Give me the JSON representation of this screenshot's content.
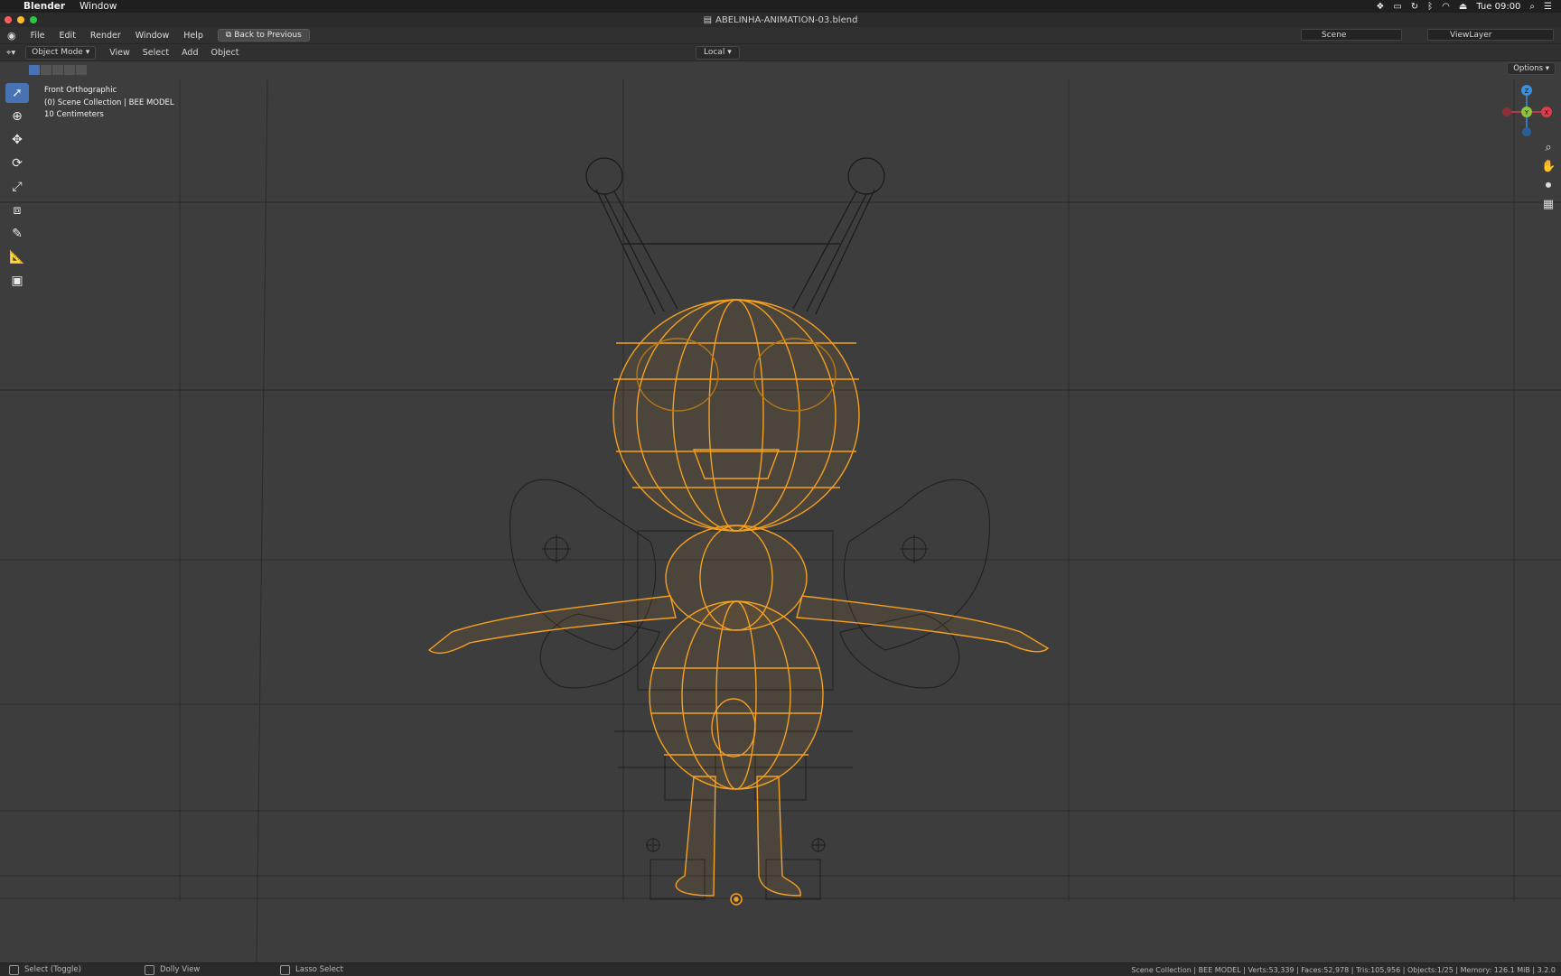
{
  "os_bar": {
    "app_name": "Blender",
    "menu": "Window",
    "clock": "Tue 09:00"
  },
  "window": {
    "title": "ABELINHA-ANIMATION-03.blend"
  },
  "menu_bar": {
    "items": [
      "File",
      "Edit",
      "Render",
      "Window",
      "Help"
    ],
    "back_button": "Back to Previous",
    "scene": "Scene",
    "view_layer": "ViewLayer"
  },
  "header": {
    "mode": "Object Mode",
    "menus": [
      "View",
      "Select",
      "Add",
      "Object"
    ],
    "pivot": "Local",
    "options": "Options"
  },
  "viewport": {
    "view_name": "Front Orthographic",
    "collection": "(0) Scene Collection | BEE MODEL",
    "scale": "10 Centimeters",
    "gizmo": {
      "z": "Z",
      "y": "Y",
      "x": "X"
    }
  },
  "status": {
    "select": "Select (Toggle)",
    "dolly": "Dolly View",
    "lasso": "Lasso Select",
    "stats": "Scene Collection | BEE MODEL | Verts:53,339 | Faces:52,978 | Tris:105,956 | Objects:1/25 | Memory: 126.1 MiB | 3.2.0"
  },
  "colors": {
    "selection_orange": "#f5a020",
    "wire_dark": "#1a1a1a",
    "active_tool_blue": "#4772b3",
    "axis_x": "#e03b4a",
    "axis_y": "#8ec43a",
    "axis_z": "#3a8fe0"
  }
}
